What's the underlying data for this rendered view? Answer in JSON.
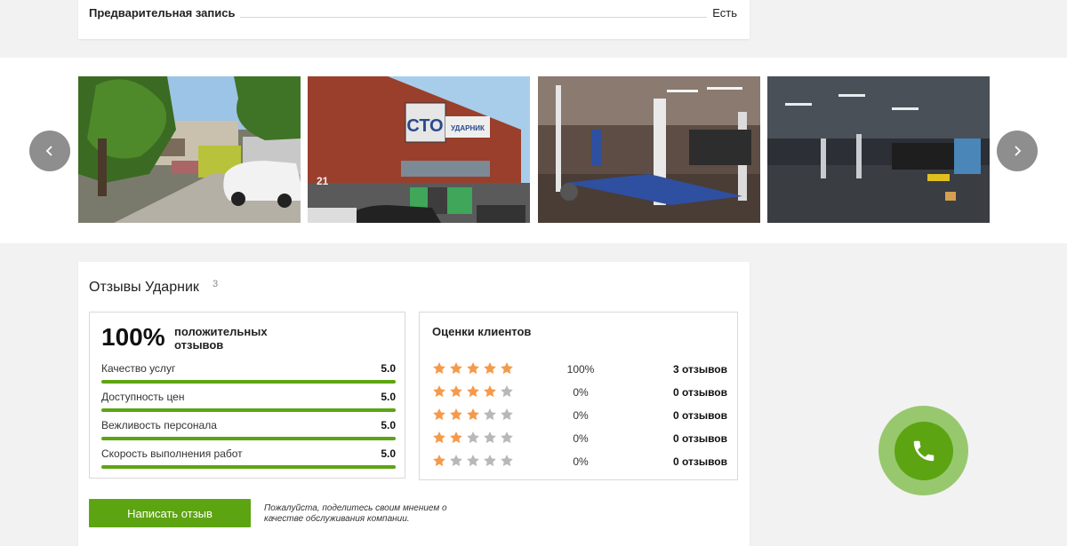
{
  "info": {
    "label": "Предварительная запись",
    "value": "Есть"
  },
  "gallery": {
    "photos": [
      {
        "icon": "photo-exterior-trees"
      },
      {
        "icon": "photo-building-sto",
        "sign_text": "СТО",
        "sign_subtext": "УДАРНИК",
        "house_number": "21"
      },
      {
        "icon": "photo-interior-lifts"
      },
      {
        "icon": "photo-interior-dark"
      }
    ],
    "prev_icon": "chevron-left-icon",
    "next_icon": "chevron-right-icon"
  },
  "reviews": {
    "title": "Отзывы Ударник",
    "count": "3",
    "summary": {
      "percent": "100%",
      "caption": "положительных отзывов",
      "metrics": [
        {
          "label": "Качество услуг",
          "score": "5.0",
          "level": 1.0
        },
        {
          "label": "Доступность цен",
          "score": "5.0",
          "level": 1.0
        },
        {
          "label": "Вежливость персонала",
          "score": "5.0",
          "level": 1.0
        },
        {
          "label": "Скорость выполнения работ",
          "score": "5.0",
          "level": 1.0
        }
      ]
    },
    "ratings": {
      "title": "Оценки клиентов",
      "rows": [
        {
          "stars": 5,
          "percent": "100%",
          "count": "3 отзывов"
        },
        {
          "stars": 4,
          "percent": "0%",
          "count": "0 отзывов"
        },
        {
          "stars": 3,
          "percent": "0%",
          "count": "0 отзывов"
        },
        {
          "stars": 2,
          "percent": "0%",
          "count": "0 отзывов"
        },
        {
          "stars": 1,
          "percent": "0%",
          "count": "0 отзывов"
        }
      ]
    },
    "write_button": "Написать отзыв",
    "write_hint": "Пожалуйста, поделитесь своим мнением о качестве обслуживания компании."
  },
  "call_button": {
    "icon": "phone-icon"
  },
  "colors": {
    "accent": "#5da412",
    "star_filled": "#f59a4a",
    "star_empty": "#b8b8b8",
    "call_ring": "#7aba42"
  }
}
